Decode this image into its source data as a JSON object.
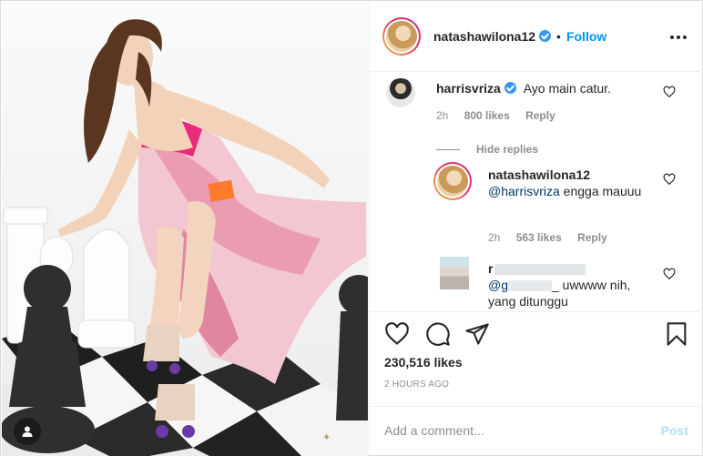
{
  "header": {
    "username": "natashawilona12",
    "separator": "•",
    "follow_label": "Follow"
  },
  "comments": [
    {
      "username": "harrisvriza",
      "text": "Ayo main catur.",
      "time": "2h",
      "likes": "800 likes",
      "reply_label": "Reply"
    }
  ],
  "hide_replies_label": "Hide replies",
  "replies": [
    {
      "username": "natashawilona12",
      "mention": "@harrisvriza",
      "text": " engga mauuu",
      "time": "2h",
      "likes": "563 likes",
      "reply_label": "Reply"
    },
    {
      "username": "r",
      "text_part1": "@g",
      "text_part2": "_ uwwww nih, yang ditunggu"
    }
  ],
  "actions": {
    "likes": "230,516 likes",
    "time_ago": "2 HOURS AGO"
  },
  "add_comment": {
    "placeholder": "Add a comment...",
    "post_label": "Post"
  },
  "colors": {
    "accent": "#0095f6",
    "post_disabled": "#b2dffc",
    "verified": "#3897f0",
    "muted": "#8e8e8e"
  },
  "icons": [
    "heart-icon",
    "comment-icon",
    "share-icon",
    "save-icon",
    "tag-user-icon",
    "more-options-icon",
    "verified-badge-icon"
  ]
}
